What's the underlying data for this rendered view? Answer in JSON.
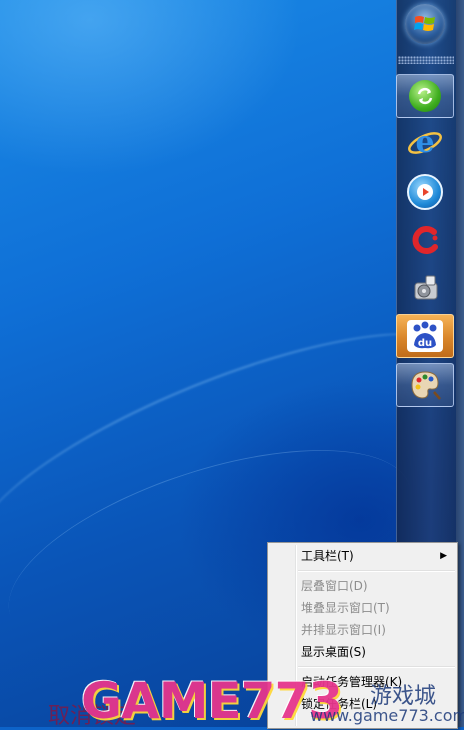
{
  "taskbar": {
    "icons": [
      {
        "name": "start-orb-icon"
      },
      {
        "name": "refresh-green-icon",
        "state": "active"
      },
      {
        "name": "internet-explorer-icon"
      },
      {
        "name": "media-player-icon"
      },
      {
        "name": "red-c-app-icon"
      },
      {
        "name": "disk-tool-icon"
      },
      {
        "name": "baidu-paw-icon",
        "state": "highlighted",
        "text": "du"
      },
      {
        "name": "paint-palette-icon",
        "state": "active"
      }
    ]
  },
  "context_menu": {
    "toolbars": "工具栏(T)",
    "cascade": "层叠窗口(D)",
    "stacked": "堆叠显示窗口(T)",
    "side_by_side": "并排显示窗口(I)",
    "show_desktop": "显示桌面(S)",
    "task_manager": "启动任务管理器(K)",
    "lock_taskbar": "锁定任务栏(L)"
  },
  "watermark": {
    "cancel_text": "取消锁定",
    "brand": "GAME773",
    "site": "游戏城",
    "domain": "www.game773.com"
  },
  "colors": {
    "menu_bg": "#f0f0f0",
    "baidu_orange": "#d9862a",
    "desktop_blue": "#0f6fd6"
  }
}
